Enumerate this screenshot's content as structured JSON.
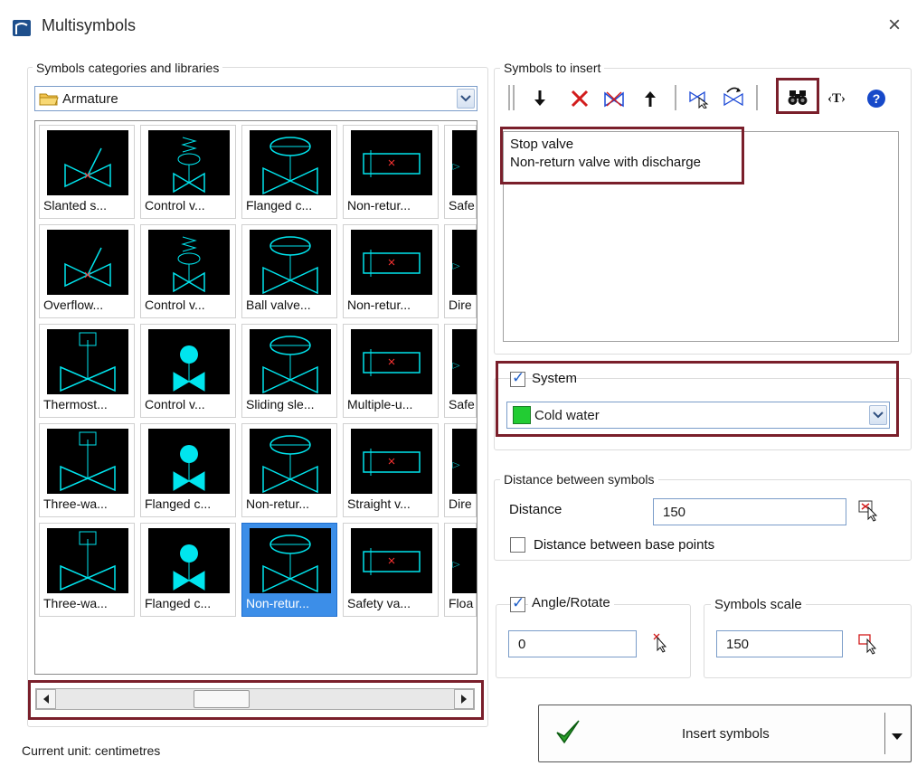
{
  "window": {
    "title": "Multisymbols",
    "icons": {
      "app": "app-icon",
      "close": "close-icon"
    },
    "close_glyph": "×"
  },
  "left": {
    "group_label": "Symbols categories and libraries",
    "category_select": {
      "value": "Armature",
      "icon": "folder-icon"
    },
    "symbols": [
      [
        "Slanted s...",
        "Control v...",
        "Flanged c...",
        "Non-retur...",
        "Safe"
      ],
      [
        "Overflow...",
        "Control v...",
        "Ball valve...",
        "Non-retur...",
        "Dire"
      ],
      [
        "Thermost...",
        "Control v...",
        "Sliding sle...",
        "Multiple-u...",
        "Safe"
      ],
      [
        "Three-wa...",
        "Flanged c...",
        "Non-retur...",
        "Straight v...",
        "Dire"
      ],
      [
        "Three-wa...",
        "Flanged c...",
        "Non-retur...",
        "Safety va...",
        "Floa"
      ]
    ],
    "selected_symbol": {
      "row": 4,
      "col": 2
    },
    "scrollbar": {
      "position_fraction": 0.4
    }
  },
  "right": {
    "insert_group_label": "Symbols to insert",
    "toolbar": [
      "move-down-icon",
      "delete-icon",
      "delete-all-icon",
      "move-up-icon",
      "select-symbol-icon",
      "replace-symbol-icon",
      "find-icon",
      "text-icon",
      "help-icon"
    ],
    "toolbar_text_glyph": "‹T›",
    "insert_list": [
      "Stop valve",
      "Non-return valve with discharge"
    ],
    "system": {
      "checked": true,
      "label": "System",
      "value": "Cold water",
      "color": "#22cc33"
    },
    "distance": {
      "group_label": "Distance between symbols",
      "label": "Distance",
      "value": "150",
      "base_points_label": "Distance between base points",
      "base_points_checked": false
    },
    "angle": {
      "checked": true,
      "label": "Angle/Rotate",
      "value": "0"
    },
    "scale": {
      "label": "Symbols scale",
      "value": "150"
    },
    "insert_button": {
      "label": "Insert symbols",
      "icon": "checkmark-icon"
    }
  },
  "status": {
    "text": "Current unit: centimetres"
  },
  "colors": {
    "accent": "#3c8ee8",
    "highlight": "#7a1f2b",
    "symbol_stroke": "#00e5ee",
    "symbol_bg": "#000000"
  }
}
